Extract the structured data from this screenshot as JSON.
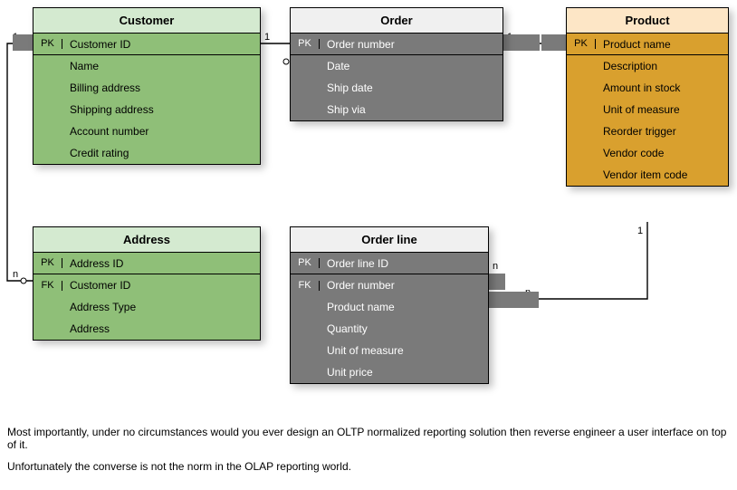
{
  "entities": {
    "customer": {
      "title": "Customer",
      "fields": [
        {
          "key": "PK",
          "name": "Customer ID"
        },
        {
          "key": "",
          "name": "Name"
        },
        {
          "key": "",
          "name": "Billing address"
        },
        {
          "key": "",
          "name": "Shipping address"
        },
        {
          "key": "",
          "name": "Account number"
        },
        {
          "key": "",
          "name": "Credit rating"
        }
      ]
    },
    "order": {
      "title": "Order",
      "fields": [
        {
          "key": "PK",
          "name": "Order number"
        },
        {
          "key": "",
          "name": "Date"
        },
        {
          "key": "",
          "name": "Ship date"
        },
        {
          "key": "",
          "name": "Ship via"
        }
      ]
    },
    "product": {
      "title": "Product",
      "fields": [
        {
          "key": "PK",
          "name": "Product name"
        },
        {
          "key": "",
          "name": "Description"
        },
        {
          "key": "",
          "name": "Amount in stock"
        },
        {
          "key": "",
          "name": "Unit of measure"
        },
        {
          "key": "",
          "name": "Reorder trigger"
        },
        {
          "key": "",
          "name": "Vendor code"
        },
        {
          "key": "",
          "name": "Vendor item code"
        }
      ]
    },
    "address": {
      "title": "Address",
      "fields": [
        {
          "key": "PK",
          "name": "Address ID"
        },
        {
          "key": "FK",
          "name": "Customer ID"
        },
        {
          "key": "",
          "name": "Address Type"
        },
        {
          "key": "",
          "name": "Address"
        }
      ]
    },
    "orderline": {
      "title": "Order line",
      "fields": [
        {
          "key": "PK",
          "name": "Order line ID"
        },
        {
          "key": "FK",
          "name": "Order number"
        },
        {
          "key": "",
          "name": "Product name"
        },
        {
          "key": "",
          "name": "Quantity"
        },
        {
          "key": "",
          "name": "Unit of measure"
        },
        {
          "key": "",
          "name": "Unit price"
        }
      ]
    }
  },
  "cardinality": {
    "one": "1",
    "n": "n"
  },
  "footer": {
    "line1": "Most importantly, under no circumstances would you ever design an OLTP normalized reporting solution then reverse engineer a user interface on top of it.",
    "line2": "Unfortunately the converse is not the norm in the OLAP reporting world."
  }
}
